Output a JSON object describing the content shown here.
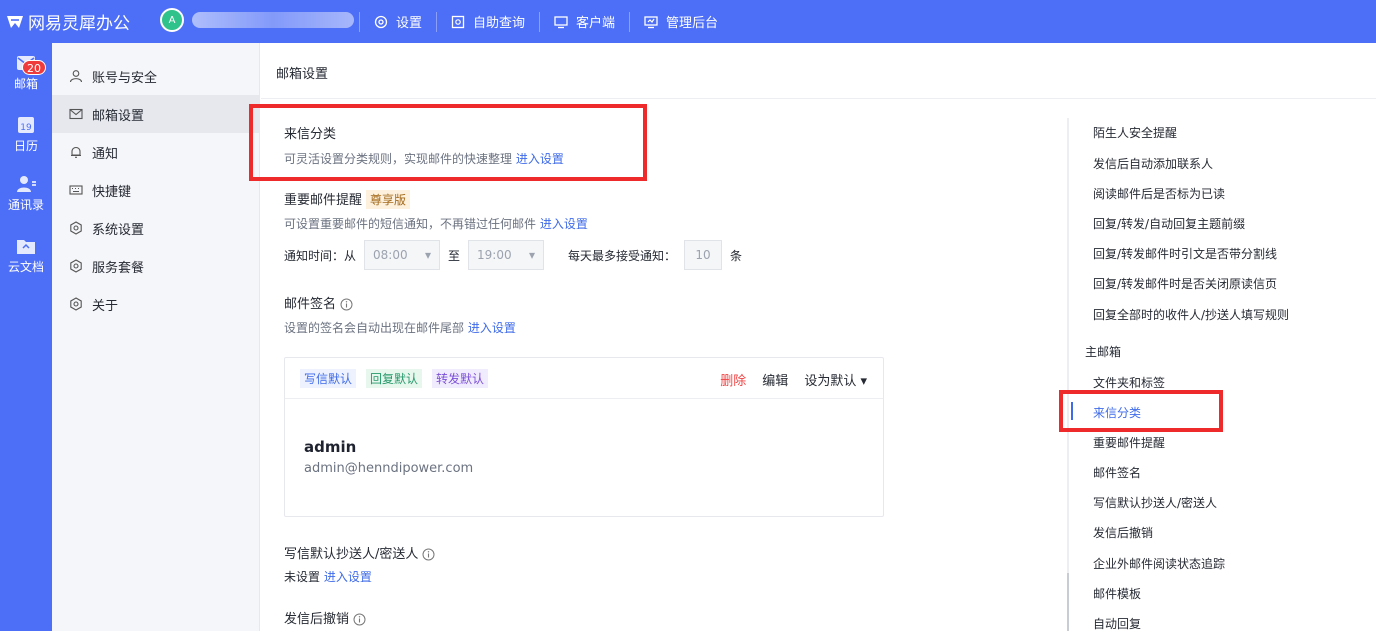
{
  "app": {
    "brand": "网易灵犀办公",
    "avatar_letter": "A"
  },
  "topnav": [
    {
      "label": "设置",
      "icon": "settings-icon"
    },
    {
      "label": "自助查询",
      "icon": "self-query-icon"
    },
    {
      "label": "客户端",
      "icon": "client-icon"
    },
    {
      "label": "管理后台",
      "icon": "admin-icon"
    }
  ],
  "rail": {
    "mail": {
      "label": "邮箱",
      "badge": "20"
    },
    "calendar": {
      "label": "日历",
      "day": "19"
    },
    "contacts": {
      "label": "通讯录"
    },
    "docs": {
      "label": "云文档"
    }
  },
  "menu": {
    "items": [
      {
        "label": "账号与安全"
      },
      {
        "label": "邮箱设置"
      },
      {
        "label": "通知"
      },
      {
        "label": "快捷键"
      },
      {
        "label": "系统设置"
      },
      {
        "label": "服务套餐"
      },
      {
        "label": "关于"
      }
    ],
    "active_index": 1
  },
  "page": {
    "title": "邮箱设置"
  },
  "classify": {
    "title": "来信分类",
    "desc": "可灵活设置分类规则，实现邮件的快速整理",
    "link": "进入设置"
  },
  "important": {
    "title": "重要邮件提醒",
    "vip": "尊享版",
    "desc": "可设置重要邮件的短信通知，不再错过任何邮件",
    "link": "进入设置",
    "time_label": "通知时间：从",
    "from": "08:00",
    "to_label": "至",
    "to": "19:00",
    "max_label": "每天最多接受通知：",
    "max": "10",
    "unit": "条"
  },
  "signature": {
    "title": "邮件签名",
    "desc": "设置的签名会自动出现在邮件尾部",
    "link": "进入设置",
    "tags": [
      "写信默认",
      "回复默认",
      "转发默认"
    ],
    "actions": {
      "delete": "删除",
      "edit": "编辑",
      "set_default": "设为默认"
    },
    "name": "admin",
    "email": "admin@henndipower.com"
  },
  "cc": {
    "title": "写信默认抄送人/密送人",
    "desc": "未设置",
    "link": "进入设置"
  },
  "recall": {
    "title": "发信后撤销"
  },
  "toc": {
    "general": [
      "陌生人安全提醒",
      "发信后自动添加联系人",
      "阅读邮件后是否标为已读",
      "回复/转发/自动回复主题前缀",
      "回复/转发邮件时引文是否带分割线",
      "回复/转发邮件时是否关闭原读信页",
      "回复全部时的收件人/抄送人填写规则"
    ],
    "main_header": "主邮箱",
    "main": [
      "文件夹和标签",
      "来信分类",
      "重要邮件提醒",
      "邮件签名",
      "写信默认抄送人/密送人",
      "发信后撤销",
      "企业外邮件阅读状态追踪",
      "邮件模板",
      "自动回复"
    ],
    "active": "来信分类"
  },
  "colors": {
    "accent": "#4d6ef7",
    "link": "#3f6be8",
    "highlight": "#ee2a2a"
  }
}
